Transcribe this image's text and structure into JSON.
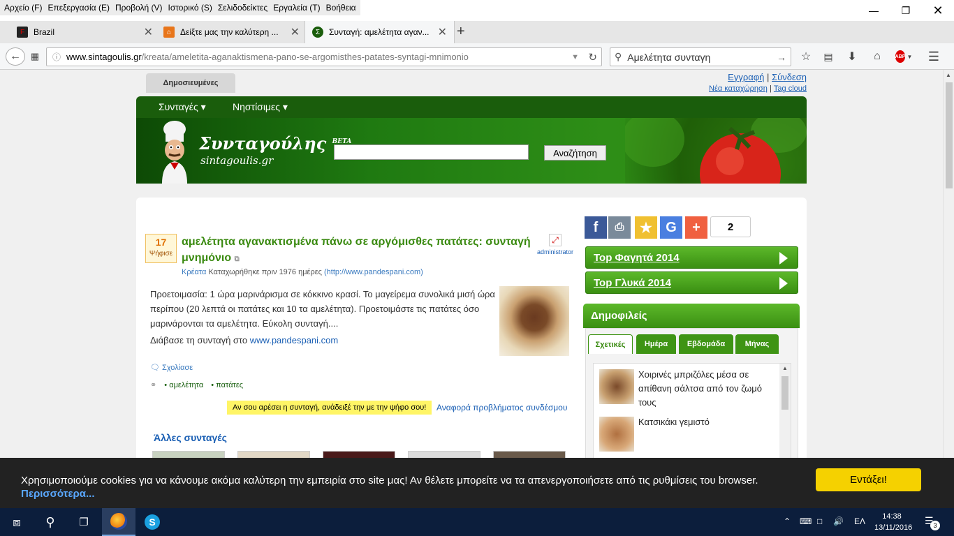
{
  "menubar": {
    "items": [
      "Αρχείο (F)",
      "Επεξεργασία (E)",
      "Προβολή (V)",
      "Ιστορικό (S)",
      "Σελιδοδείκτες",
      "Εργαλεία (T)",
      "Βοήθεια"
    ]
  },
  "tabs": [
    {
      "title": "Brazil"
    },
    {
      "title": "Δείξτε μας την καλύτερη ..."
    },
    {
      "title": "Συνταγή: αμελέτητα αγαν..."
    }
  ],
  "nav": {
    "url_host": "www.sintagoulis.gr",
    "url_path": "/kreata/ameletita-aganaktismena-pano-se-argomisthes-patates-syntagi-mnimonio",
    "search_value": "Αμελέτητα συνταγη",
    "abp": "ABP"
  },
  "site": {
    "top_tab": "Δημοσιευμένες",
    "register": "Εγγραφή",
    "login": "Σύνδεση",
    "sep": "|",
    "new_entry": "Νέα καταχώρηση",
    "tag_cloud": "Tag cloud",
    "menu_recipes": "Συνταγές",
    "menu_lent": "Νηστίσιμες",
    "brand": "Συνταγούλης",
    "brand_beta": "BETA",
    "brand_sub": "sintagoulis.gr",
    "search_button": "Αναζήτηση"
  },
  "recipe": {
    "votes": "17",
    "votes_label": "Ψήφισε",
    "title": "αμελέτητα αγανακτισμένα πάνω σε αργόμισθες πατάτες: συνταγή μνημόνιο",
    "category": "Κρέατα",
    "posted": "Καταχωρήθηκε πριν 1976 ημέρες",
    "source": "(http://www.pandespani.com)",
    "author": "administrator",
    "description": "Προετοιμασία: 1 ώρα μαρινάρισμα σε κόκκινο κρασί. Το μαγείρεμα συνολικά μισή ώρα περίπου (20 λεπτά οι πατάτες και 10 τα αμελέτητα). Προετοιμάστε τις πατάτες όσο μαρινάρονται τα αμελέτητα. Εύκολη συνταγή....",
    "read_more_prefix": "Διάβασε τη συνταγή στο",
    "read_more_link": "www.pandespani.com",
    "comment": "Σχολίασε",
    "tags": [
      "αμελέτητα",
      "πατάτες"
    ],
    "vote_hint": "Αν σου αρέσει η συνταγή, ανάδειξέ την με την ψήφο σου!",
    "report": "Αναφορά προβλήματος συνδέσμου",
    "other_recipes": "Άλλες συνταγές"
  },
  "sidebar": {
    "share_count": "2",
    "top_food": "Top Φαγητά 2014",
    "top_sweets": "Top Γλυκά 2014",
    "popular": "Δημοφιλείς",
    "tabs": [
      "Σχετικές",
      "Ημέρα",
      "Εβδομάδα",
      "Μήνας"
    ],
    "items": [
      "Χοιρινές μπριζόλες μέσα σε απίθανη σάλτσα από τον ζωμό τους",
      "Κατσικάκι γεμιστό"
    ]
  },
  "cookie": {
    "text": "Χρησιμοποιούμε cookies για να κάνουμε ακόμα καλύτερη την εμπειρία στο site μας! Αν θέλετε μπορείτε να τα απενεργοποιήσετε από τις ρυθμίσεις του browser.",
    "more": "Περισσότερα...",
    "accept": "Εντάξει!"
  },
  "taskbar": {
    "lang": "ΕΛ",
    "time": "14:38",
    "date": "13/11/2016",
    "notif_count": "3"
  },
  "colors": {
    "site_green": "#1a5d0c",
    "button_green": "#3a8f12",
    "link_blue": "#1a5fb4",
    "cookie_yellow": "#f5d100"
  }
}
